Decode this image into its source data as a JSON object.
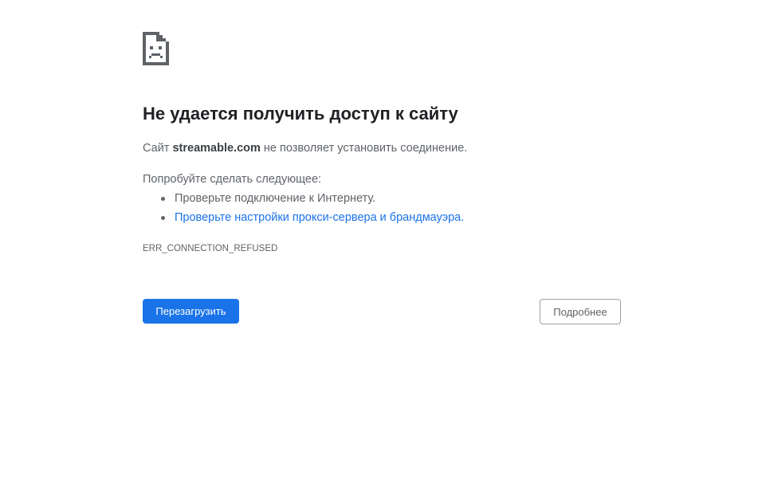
{
  "error_page": {
    "icon": "sad-document-icon",
    "title": "Не удается получить доступ к сайту",
    "summary": {
      "prefix": "Сайт ",
      "host": "streamable.com",
      "suffix": " не позволяет установить соединение."
    },
    "suggestions_heading": "Попробуйте сделать следующее:",
    "suggestions": [
      {
        "text": "Проверьте подключение к Интернету.",
        "is_link": false
      },
      {
        "text": "Проверьте настройки прокси-сервера и брандмауэра",
        "trailing": ".",
        "is_link": true
      }
    ],
    "error_code": "ERR_CONNECTION_REFUSED",
    "reload_label": "Перезагрузить",
    "details_label": "Подробнее",
    "colors": {
      "primary_button": "#1a73e8",
      "link": "#1a73e8",
      "title_text": "#202124",
      "body_text": "#5f6368"
    }
  }
}
